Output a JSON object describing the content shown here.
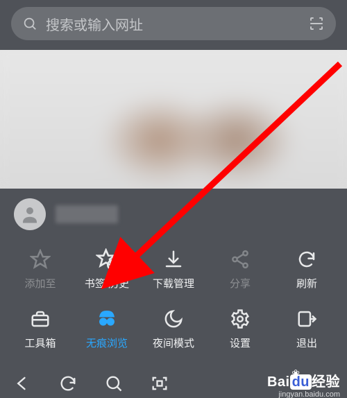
{
  "search": {
    "placeholder": "搜索或输入网址"
  },
  "menu": {
    "addTo": {
      "label": "添加至"
    },
    "bookmarks": {
      "label": "书签/历史"
    },
    "downloads": {
      "label": "下载管理"
    },
    "share": {
      "label": "分享"
    },
    "refresh": {
      "label": "刷新"
    },
    "toolbox": {
      "label": "工具箱"
    },
    "incognito": {
      "label": "无痕浏览"
    },
    "night": {
      "label": "夜间模式"
    },
    "settings": {
      "label": "设置"
    },
    "exit": {
      "label": "退出"
    }
  },
  "watermark": {
    "brandLeft": "Bai",
    "brandBox": "du",
    "brandRight": "经验",
    "url": "jingyan.baidu.com"
  },
  "colors": {
    "accent": "#2aa8ff",
    "arrow": "#ff0000",
    "bg": "#4f5258"
  }
}
